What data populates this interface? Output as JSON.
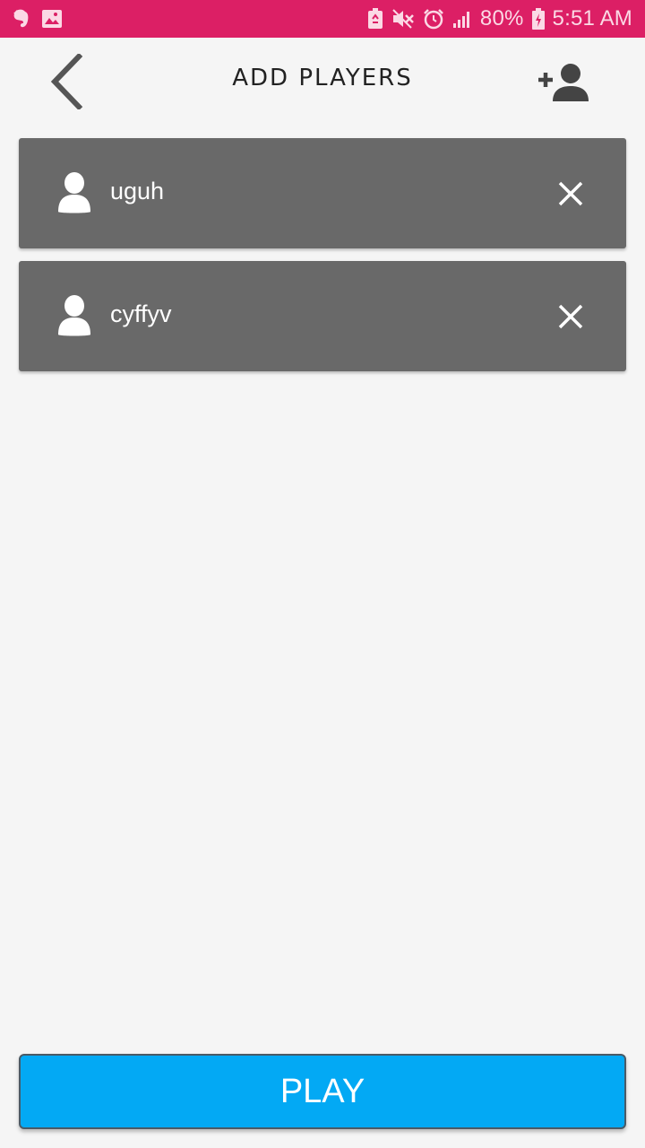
{
  "status_bar": {
    "battery_percent": "80%",
    "time": "5:51 AM",
    "color": "#dc1f65",
    "left_icons": [
      "evernote-icon",
      "image-icon"
    ],
    "right_icons": [
      "recycle-icon",
      "mute-icon",
      "alarm-icon",
      "signal-icon",
      "battery-charging-icon"
    ]
  },
  "toolbar": {
    "title": "ADD PLAYERS",
    "back_icon": "chevron-left-icon",
    "add_icon": "add-person-icon"
  },
  "players": [
    {
      "name": "uguh",
      "icon": "person-icon",
      "remove_icon": "close-icon"
    },
    {
      "name": "cyffyv",
      "icon": "person-icon",
      "remove_icon": "close-icon"
    }
  ],
  "play_button": {
    "label": "PLAY",
    "color": "#03a9f4"
  }
}
